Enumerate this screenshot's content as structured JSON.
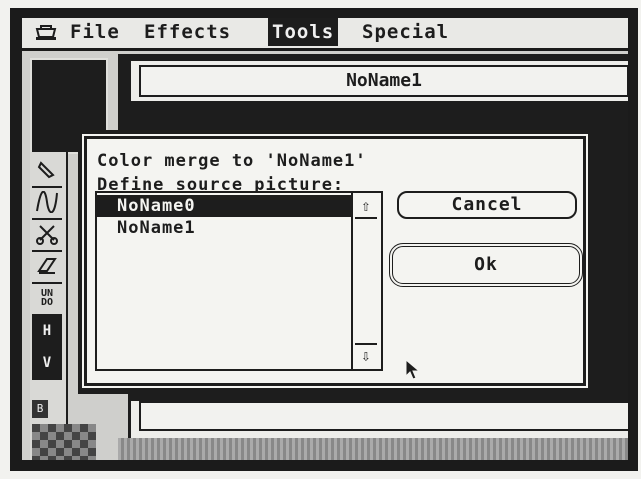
{
  "menu_bar": {
    "items": [
      "File",
      "Effects",
      "Tools",
      "Special"
    ],
    "active": "Tools"
  },
  "window": {
    "title": "NoName1"
  },
  "toolbox": {
    "undo_label": "UN\nDO",
    "h_label": "H",
    "v_label": "V",
    "b_label": "B"
  },
  "dialog": {
    "prompt": "Color merge to 'NoName1'",
    "list_label": "Define source picture:",
    "list_items": [
      {
        "label": "NoName0",
        "selected": true
      },
      {
        "label": "NoName1",
        "selected": false
      }
    ],
    "cancel_label": "Cancel",
    "ok_label": "Ok",
    "scroll_up_glyph": "⇧",
    "scroll_down_glyph": "⇩"
  }
}
